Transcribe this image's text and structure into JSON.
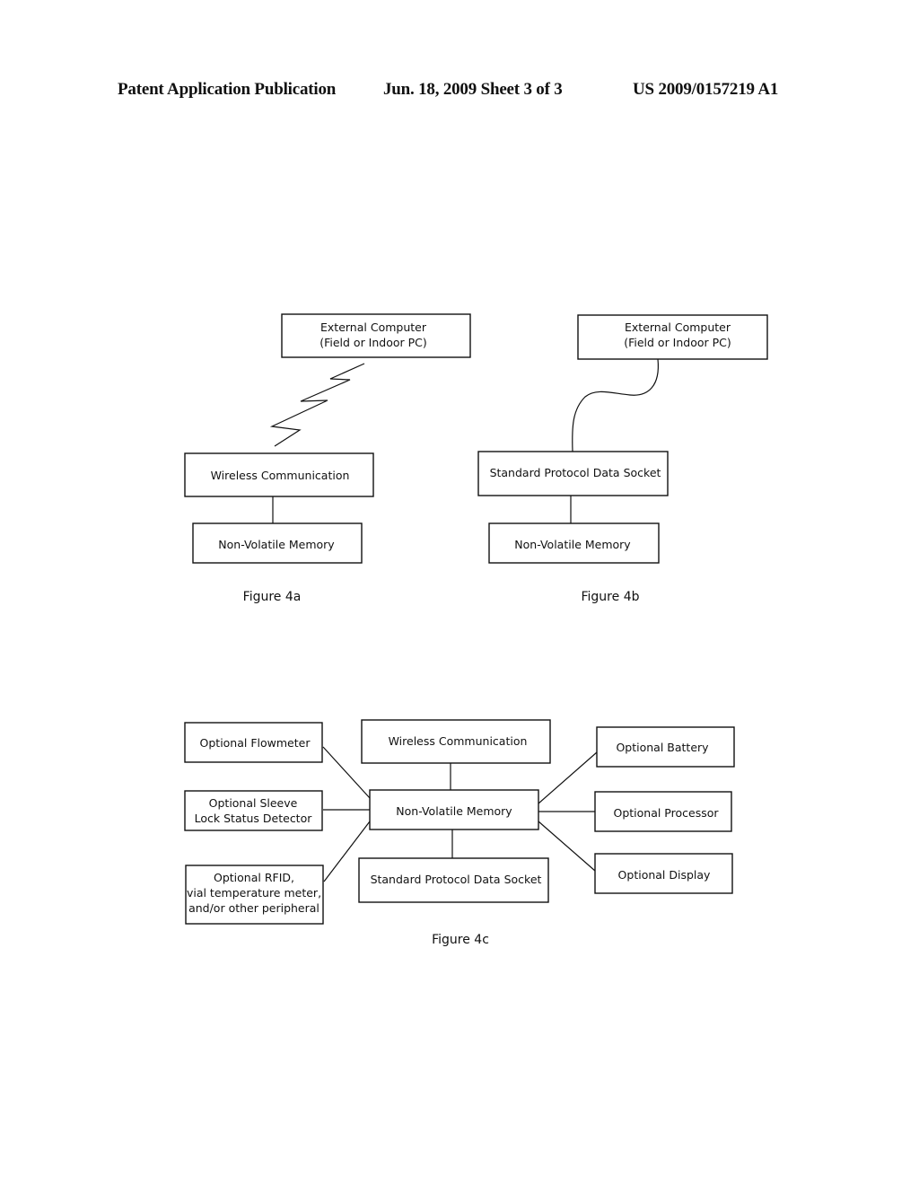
{
  "header": {
    "publication": "Patent Application Publication",
    "date_sheet": "Jun. 18, 2009  Sheet 3 of 3",
    "number": "US 2009/0157219 A1"
  },
  "fig4a": {
    "caption": "Figure 4a",
    "external_computer": [
      "External Computer",
      "(Field or Indoor PC)"
    ],
    "wireless": "Wireless Communication",
    "memory": "Non-Volatile Memory",
    "link_type": "wireless"
  },
  "fig4b": {
    "caption": "Figure 4b",
    "external_computer": [
      "External Computer",
      "(Field or Indoor PC)"
    ],
    "socket": "Standard Protocol Data Socket",
    "memory": "Non-Volatile Memory",
    "link_type": "cable"
  },
  "fig4c": {
    "caption": "Figure 4c",
    "center": "Non-Volatile Memory",
    "wireless": "Wireless Communication",
    "socket": "Standard Protocol Data Socket",
    "flowmeter": "Optional Flowmeter",
    "sleeve": [
      "Optional Sleeve",
      "Lock Status Detector"
    ],
    "rfid": [
      "Optional RFID,",
      "vial temperature meter,",
      "and/or other peripheral"
    ],
    "battery": "Optional Battery",
    "processor": "Optional Processor",
    "display": "Optional Display"
  }
}
